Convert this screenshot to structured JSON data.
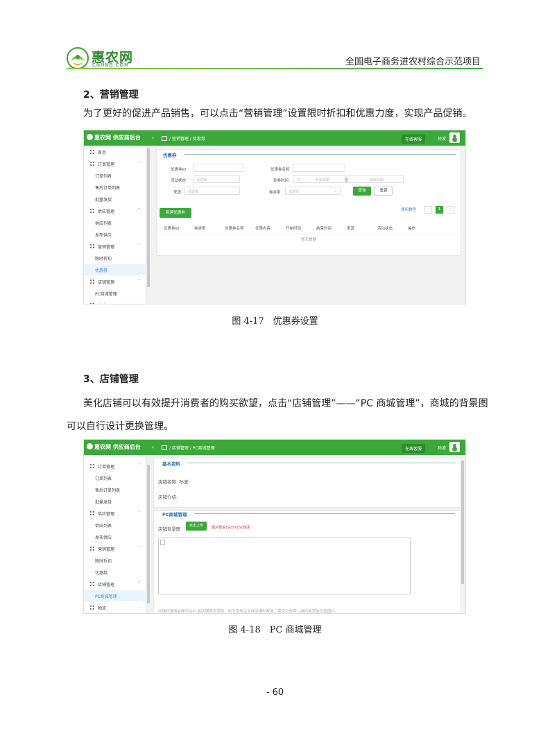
{
  "header": {
    "logo_name": "惠农网",
    "logo_sub": "CNHNB.COM",
    "title": "全国电子商务进农村综合示范项目"
  },
  "section2": {
    "title": "2、营销管理",
    "text": "为了更好的促进产品销售，可以点击“营销管理”设置限时折扣和优惠力度，实现产品促销。"
  },
  "section3": {
    "title": "3、店铺管理",
    "text": "美化店铺可以有效提升消费者的购买欲望，点击“店铺管理”——“PC 商城管理”，商城的背景图可以自行设计更换管理。"
  },
  "shot1": {
    "topbar": {
      "logo": "惠农网 供应商后台",
      "arrow": "‹",
      "crumb": "/ 营销管理 / 优惠券",
      "online": "在线客服",
      "user": "孙波"
    },
    "sidebar": [
      {
        "label": "首页",
        "type": "group",
        "caret": ""
      },
      {
        "label": "订单管理",
        "type": "group",
        "caret": "^"
      },
      {
        "label": "订单列表",
        "type": "child"
      },
      {
        "label": "售后订单列表",
        "type": "child"
      },
      {
        "label": "批量发货",
        "type": "child"
      },
      {
        "label": "供应管理",
        "type": "group",
        "caret": "^"
      },
      {
        "label": "供应列表",
        "type": "child"
      },
      {
        "label": "发布供应",
        "type": "child"
      },
      {
        "label": "营销管理",
        "type": "group",
        "caret": "^"
      },
      {
        "label": "限时折扣",
        "type": "child"
      },
      {
        "label": "优惠券",
        "type": "child",
        "active": true
      },
      {
        "label": "店铺管理",
        "type": "group",
        "caret": "^"
      },
      {
        "label": "PC商城管理",
        "type": "child"
      },
      {
        "label": "物流",
        "type": "group",
        "caret": ""
      }
    ],
    "panel_title": "优惠券",
    "form": {
      "coupon_id_label": "优惠券ID",
      "coupon_name_label": "优惠券名称",
      "status_label": "活动状态",
      "status_placeholder": "请选择",
      "issue_time_label": "发券时间",
      "start_placeholder": "开始日期",
      "to_label": "至",
      "end_placeholder": "结束日期",
      "source_label": "来源",
      "source_placeholder": "请选择",
      "type_label": "券类型",
      "type_placeholder": "请选择",
      "search_button": "查询",
      "reset_button": "重置",
      "dropdown_glyph": "⌄"
    },
    "new_button": "新建优惠券",
    "help_link": "使用教程",
    "pager": {
      "prev": "‹",
      "current": "1",
      "next": "›"
    },
    "columns": [
      "优惠券ID",
      "券类型",
      "优惠券名称",
      "优惠内容",
      "开始时间",
      "结束时间",
      "来源",
      "活动状态",
      "操作"
    ],
    "empty_text": "暂无数据"
  },
  "caption1": "图 4-17　优惠券设置",
  "shot2": {
    "topbar": {
      "logo": "惠农网 供应商后台",
      "arrow": "‹",
      "crumb": "/ 店铺管理 / PC商城管理",
      "online": "在线客服",
      "user": "孙波"
    },
    "sidebar": [
      {
        "label": "订单管理",
        "type": "group",
        "caret": "^"
      },
      {
        "label": "订单列表",
        "type": "child"
      },
      {
        "label": "售后订单列表",
        "type": "child"
      },
      {
        "label": "批量发货",
        "type": "child"
      },
      {
        "label": "供应管理",
        "type": "group",
        "caret": "^"
      },
      {
        "label": "供应列表",
        "type": "child"
      },
      {
        "label": "发布供应",
        "type": "child"
      },
      {
        "label": "营销管理",
        "type": "group",
        "caret": "^"
      },
      {
        "label": "限时折扣",
        "type": "child"
      },
      {
        "label": "优惠券",
        "type": "child"
      },
      {
        "label": "店铺管理",
        "type": "group",
        "caret": "^"
      },
      {
        "label": "PC商城管理",
        "type": "child",
        "active": true
      },
      {
        "label": "物流",
        "type": "group",
        "caret": "⌄"
      }
    ],
    "basic_title": "基本资料",
    "shop_name": "店铺名称: 孙波",
    "shop_intro": "店铺介绍:",
    "pc_title": "PC商城管理",
    "bg_label": "店铺背景图",
    "upload_button": "点击上传",
    "size_tip": "图片要求1920X150像素",
    "bottom_note": "店铺背景图会展示在PC版店铺首页顶部，用于宣传企业或店铺形象用，需您上传带二维码或其他仿冒图片。"
  },
  "caption2": "图 4-18　PC 商城管理",
  "page_number": "- 60"
}
